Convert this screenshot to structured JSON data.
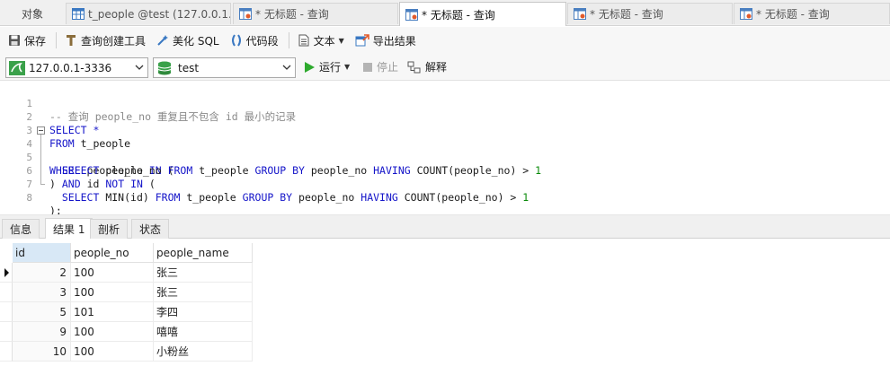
{
  "tabs": [
    {
      "label": "对象"
    },
    {
      "label": "t_people @test (127.0.0.1..."
    },
    {
      "label": "* 无标题 - 查询"
    },
    {
      "label": "* 无标题 - 查询"
    },
    {
      "label": "* 无标题 - 查询"
    },
    {
      "label": "* 无标题 - 查询"
    }
  ],
  "toolbar": {
    "save": "保存",
    "query_builder": "查询创建工具",
    "beautify": "美化 SQL",
    "snippet": "代码段",
    "text": "文本",
    "export": "导出结果"
  },
  "connection": {
    "server": "127.0.0.1-3336",
    "database": "test",
    "run": "运行",
    "stop": "停止",
    "explain": "解释"
  },
  "editor": {
    "line_numbers": [
      "1",
      "2",
      "3",
      "4",
      "5",
      "6",
      "7",
      "8"
    ],
    "lines": [
      "-- 查询 people_no 重复且不包含 id 最小的记录",
      "SELECT *",
      "FROM t_people",
      "WHERE people_no IN (",
      "  SELECT people_no FROM t_people GROUP BY people_no HAVING COUNT(people_no) > 1",
      ") AND id NOT IN (",
      "  SELECT MIN(id) FROM t_people GROUP BY people_no HAVING COUNT(people_no) > 1",
      ");"
    ]
  },
  "result_tabs": [
    "信息",
    "结果 1",
    "剖析",
    "状态"
  ],
  "grid": {
    "columns": [
      "id",
      "people_no",
      "people_name"
    ],
    "rows": [
      [
        "2",
        "100",
        "张三"
      ],
      [
        "3",
        "100",
        "张三"
      ],
      [
        "5",
        "101",
        "李四"
      ],
      [
        "9",
        "100",
        "嘻嘻"
      ],
      [
        "10",
        "100",
        "小粉丝"
      ]
    ]
  },
  "colors": {
    "keyword": "#1515c9",
    "comment": "#8a8a8a",
    "number": "#0a8a0a",
    "run_green": "#2eaa2e"
  }
}
